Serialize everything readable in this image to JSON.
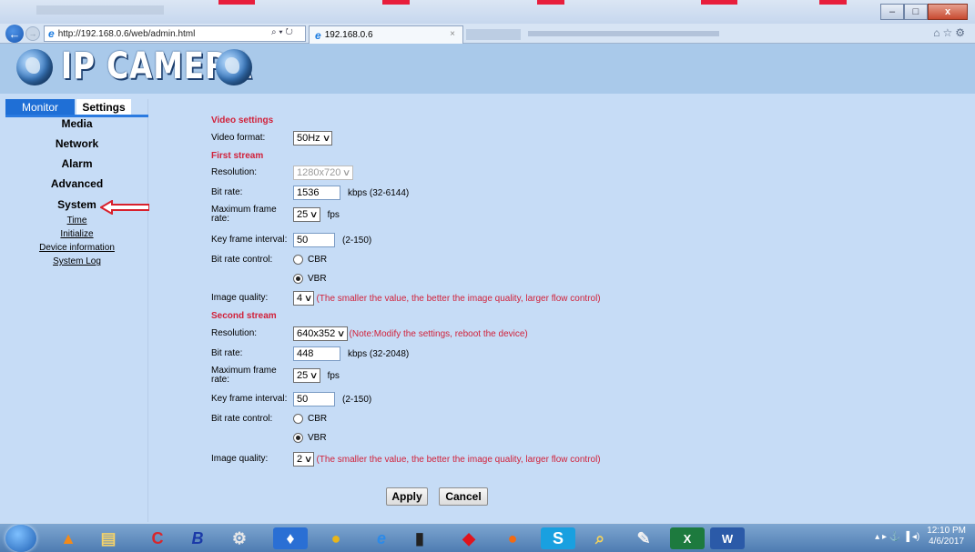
{
  "browser": {
    "url": "http://192.168.0.6/web/admin.html",
    "tab_title": "192.168.0.6",
    "addr_tools": "⌕ ▾ ↻",
    "tab_close": "×",
    "toolbar_icons": "⌂☆⚙"
  },
  "banner": {
    "logo_text": "IP CAMERA"
  },
  "sidebar": {
    "tabs": [
      "Monitor",
      "Settings"
    ],
    "menu": [
      "Media",
      "Network",
      "Alarm",
      "Advanced",
      "System"
    ],
    "submenu": [
      "Time",
      "Initialize",
      "Device information",
      "System Log"
    ]
  },
  "form": {
    "video_settings_title": "Video settings",
    "video_format_label": "Video format:",
    "video_format_value": "50Hz",
    "first_stream_title": "First stream",
    "first": {
      "resolution_label": "Resolution:",
      "resolution_value": "1280x720",
      "bit_rate_label": "Bit rate:",
      "bit_rate_value": "1536",
      "bit_rate_hint": "kbps (32-6144)",
      "max_frame_rate_label": "Maximum frame rate:",
      "max_frame_rate_value": "25",
      "fps_label": "fps",
      "key_frame_label": "Key frame interval:",
      "key_frame_value": "50",
      "key_frame_hint": "(2-150)",
      "bit_rate_control_label": "Bit rate control:",
      "cbr": "CBR",
      "vbr": "VBR",
      "image_quality_label": "Image quality:",
      "image_quality_value": "4",
      "image_quality_note": "(The smaller the value, the better the image quality, larger flow control)"
    },
    "second_stream_title": "Second stream",
    "second": {
      "resolution_label": "Resolution:",
      "resolution_value": "640x352",
      "resolution_note": "(Note:Modify the settings, reboot the device)",
      "bit_rate_label": "Bit rate:",
      "bit_rate_value": "448",
      "bit_rate_hint": "kbps (32-2048)",
      "max_frame_rate_label": "Maximum frame rate:",
      "max_frame_rate_value": "25",
      "fps_label": "fps",
      "key_frame_label": "Key frame interval:",
      "key_frame_value": "50",
      "key_frame_hint": "(2-150)",
      "bit_rate_control_label": "Bit rate control:",
      "cbr": "CBR",
      "vbr": "VBR",
      "image_quality_label": "Image quality:",
      "image_quality_value": "2",
      "image_quality_note": "(The smaller the value, the better the image quality, larger flow control)"
    },
    "apply_label": "Apply",
    "cancel_label": "Cancel"
  },
  "taskbar": {
    "app_glyphs": [
      "▲",
      "▤",
      "C",
      "B",
      "⚙",
      "♦",
      "●",
      "e",
      "▮",
      "◆",
      "●",
      "S",
      "⌕",
      "✎",
      "X",
      "W"
    ],
    "tray_icons": "▴ ▸ ⚓ ▐ ◂)",
    "time": "12:10 PM",
    "date": "4/6/2017"
  },
  "colors": {
    "accent_red": "#d1213a",
    "sidebar_blue": "#1f6fd6",
    "page_bg": "#c6dcf6"
  }
}
